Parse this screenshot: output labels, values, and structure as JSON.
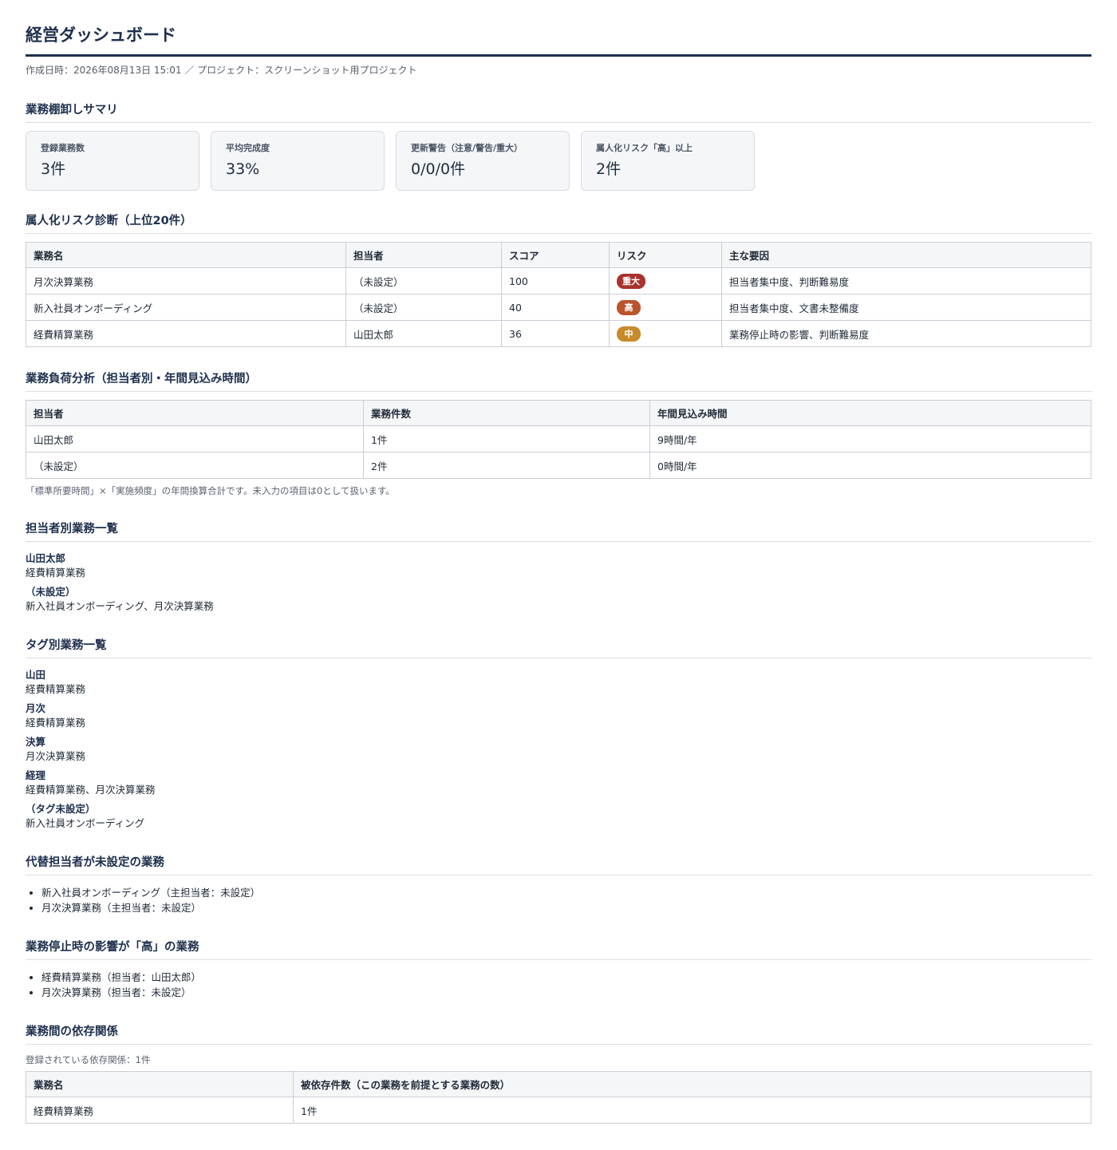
{
  "header": {
    "title": "経営ダッシュボード",
    "meta": "作成日時：2026年08月13日 15:01 ／ プロジェクト：スクリーンショット用プロジェクト"
  },
  "summary": {
    "title": "業務棚卸しサマリ",
    "cards": [
      {
        "label": "登録業務数",
        "value": "3件"
      },
      {
        "label": "平均完成度",
        "value": "33%"
      },
      {
        "label": "更新警告（注意/警告/重大）",
        "value": "0/0/0件"
      },
      {
        "label": "属人化リスク「高」以上",
        "value": "2件"
      }
    ]
  },
  "risk": {
    "title": "属人化リスク診断（上位20件）",
    "headers": [
      "業務名",
      "担当者",
      "スコア",
      "リスク",
      "主な要因"
    ],
    "rows": [
      {
        "name": "月次決算業務",
        "owner": "（未設定）",
        "score": "100",
        "risk": "重大",
        "risk_color": "#a8322d",
        "factors": "担当者集中度、判断難易度"
      },
      {
        "name": "新入社員オンボーディング",
        "owner": "（未設定）",
        "score": "40",
        "risk": "高",
        "risk_color": "#b9542d",
        "factors": "担当者集中度、文書未整備度"
      },
      {
        "name": "経費精算業務",
        "owner": "山田太郎",
        "score": "36",
        "risk": "中",
        "risk_color": "#c98a2c",
        "factors": "業務停止時の影響、判断難易度"
      }
    ]
  },
  "load": {
    "title": "業務負荷分析（担当者別・年間見込み時間）",
    "headers": [
      "担当者",
      "業務件数",
      "年間見込み時間"
    ],
    "rows": [
      {
        "owner": "山田太郎",
        "count": "1件",
        "hours": "9時間/年"
      },
      {
        "owner": "（未設定）",
        "count": "2件",
        "hours": "0時間/年"
      }
    ],
    "note": "「標準所要時間」×「実施頻度」の年間換算合計です。未入力の項目は0として扱います。"
  },
  "by_owner": {
    "title": "担当者別業務一覧",
    "groups": [
      {
        "name": "山田太郎",
        "items": "経費精算業務"
      },
      {
        "name": "（未設定）",
        "items": "新入社員オンボーディング、月次決算業務"
      }
    ]
  },
  "by_tag": {
    "title": "タグ別業務一覧",
    "groups": [
      {
        "name": "山田",
        "items": "経費精算業務"
      },
      {
        "name": "月次",
        "items": "経費精算業務"
      },
      {
        "name": "決算",
        "items": "月次決算業務"
      },
      {
        "name": "経理",
        "items": "経費精算業務、月次決算業務"
      },
      {
        "name": "（タグ未設定）",
        "items": "新入社員オンボーディング"
      }
    ]
  },
  "no_backup": {
    "title": "代替担当者が未設定の業務",
    "items": [
      "新入社員オンボーディング（主担当者：未設定）",
      "月次決算業務（主担当者：未設定）"
    ]
  },
  "high_impact": {
    "title": "業務停止時の影響が「高」の業務",
    "items": [
      "経費精算業務（担当者：山田太郎）",
      "月次決算業務（担当者：未設定）"
    ]
  },
  "dependencies": {
    "title": "業務間の依存関係",
    "meta": "登録されている依存関係：1件",
    "headers": [
      "業務名",
      "被依存件数（この業務を前提とする業務の数）"
    ],
    "rows": [
      {
        "name": "経費精算業務",
        "count": "1件"
      }
    ]
  }
}
